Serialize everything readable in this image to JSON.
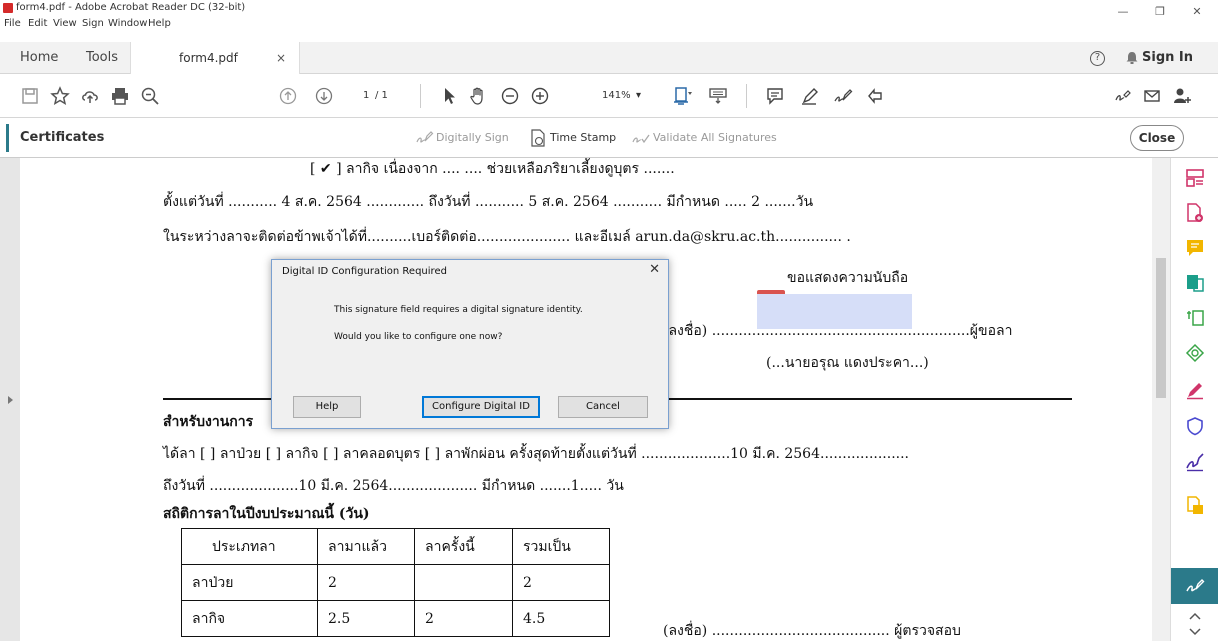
{
  "window": {
    "title": "form4.pdf - Adobe Acrobat Reader DC (32-bit)",
    "minimize": "—",
    "restore": "❐",
    "close": "✕"
  },
  "menu": [
    "File",
    "Edit",
    "View",
    "Sign",
    "Window",
    "Help"
  ],
  "tabs": {
    "home": "Home",
    "tools": "Tools",
    "document": "form4.pdf",
    "close": "×"
  },
  "account": {
    "help": "?",
    "signin": "Sign In"
  },
  "toolbar": {
    "page_current": "1",
    "page_total": "/ 1",
    "zoom": "141%",
    "zoom_caret": "▾"
  },
  "certificates": {
    "title": "Certificates",
    "digitally_sign": "Digitally Sign",
    "time_stamp": "Time Stamp",
    "validate_all": "Validate All Signatures",
    "close": "Close"
  },
  "document": {
    "line_leave": "[ ✔ ]  ลากิจ  เนื่องจาก .... .... ช่วยเหลือภริยาเลี้ยงดูบุตร .......",
    "line_dates": "ตั้งแต่วันที่ ........... 4 ส.ค. 2564 ............. ถึงวันที่ ........... 5 ส.ค. 2564 ........... มีกำหนด ..... 2 .......วัน",
    "line_contact": "ในระหว่างลาจะติดต่อข้าพเจ้าได้ที่..........เบอร์ติดต่อ..................... และอีเมล์ arun.da@skru.ac.th............... .",
    "respect": "ขอแสดงความนับถือ",
    "sign_line": "(ลงชื่อ)  ..........................................................ผู้ขอลา",
    "signer_name": "(...นายอรุณ แดงประคา...)",
    "section_heading": "สำหรับงานการ",
    "line_prev_leave": "ได้ลา [ ] ลาป่วย [ ] ลากิจ [ ] ลาคลอดบุตร [ ] ลาพักผ่อน  ครั้งสุดท้ายตั้งแต่วันที่ ....................10 มี.ค. 2564....................",
    "line_prev_until": "ถึงวันที่ ....................10 มี.ค. 2564.................... มีกำหนด .......1..... วัน",
    "stats_heading": "สถิติการลาในปีงบประมาณนี้ (วัน)",
    "checker_sign": "(ลงชื่อ) ........................................ ผู้ตรวจสอบ",
    "table": {
      "headers": [
        "ประเภทลา",
        "ลามาแล้ว",
        "ลาครั้งนี้",
        "รวมเป็น"
      ],
      "rows": [
        [
          "ลาป่วย",
          "2",
          "",
          "2"
        ],
        [
          "ลากิจ",
          "2.5",
          "2",
          "4.5"
        ]
      ]
    }
  },
  "dialog": {
    "title": "Digital ID Configuration Required",
    "close": "✕",
    "message1": "This signature field requires a digital signature identity.",
    "message2": "Would you like to configure one now?",
    "help": "Help",
    "configure": "Configure Digital ID",
    "cancel": "Cancel"
  },
  "colors": {
    "accent": "#2b7a8a",
    "acrobat_red": "#d42a2a",
    "signature_field": "#d6def8"
  }
}
